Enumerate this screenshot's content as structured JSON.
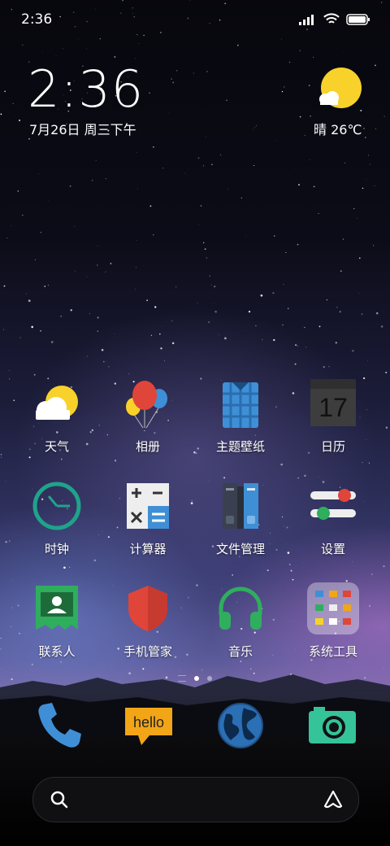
{
  "status_bar": {
    "time": "2:36",
    "icons": [
      "signal-icon",
      "wifi-icon",
      "battery-icon"
    ]
  },
  "clock_widget": {
    "time": "2:36",
    "date": "7月26日 周三下午"
  },
  "weather_widget": {
    "condition": "晴 26℃",
    "icon": "sun-cloud-icon"
  },
  "apps": [
    {
      "label": "天气",
      "icon": "weather-icon"
    },
    {
      "label": "相册",
      "icon": "balloons-icon"
    },
    {
      "label": "主题壁纸",
      "icon": "shirt-icon"
    },
    {
      "label": "日历",
      "icon": "calendar-icon",
      "day": "17"
    },
    {
      "label": "时钟",
      "icon": "clock-icon"
    },
    {
      "label": "计算器",
      "icon": "calculator-icon"
    },
    {
      "label": "文件管理",
      "icon": "folders-icon"
    },
    {
      "label": "设置",
      "icon": "toggles-icon"
    },
    {
      "label": "联系人",
      "icon": "contacts-icon"
    },
    {
      "label": "手机管家",
      "icon": "shield-icon"
    },
    {
      "label": "音乐",
      "icon": "headphones-icon"
    },
    {
      "label": "系统工具",
      "icon": "folder-icon"
    }
  ],
  "pager": {
    "pages": 3,
    "active": 2
  },
  "dock": [
    {
      "icon": "phone-icon"
    },
    {
      "icon": "message-icon",
      "text": "hello"
    },
    {
      "icon": "browser-globe-icon"
    },
    {
      "icon": "camera-icon"
    }
  ],
  "search_bar": {
    "left_icon": "search-icon",
    "right_icon": "assistant-icon"
  },
  "colors": {
    "sun": "#f8d22a",
    "calendar_bg": "#3d3d3d",
    "green": "#2fae5e",
    "blue": "#3f8fd6",
    "red": "#e0453a",
    "orange": "#f2a516"
  }
}
